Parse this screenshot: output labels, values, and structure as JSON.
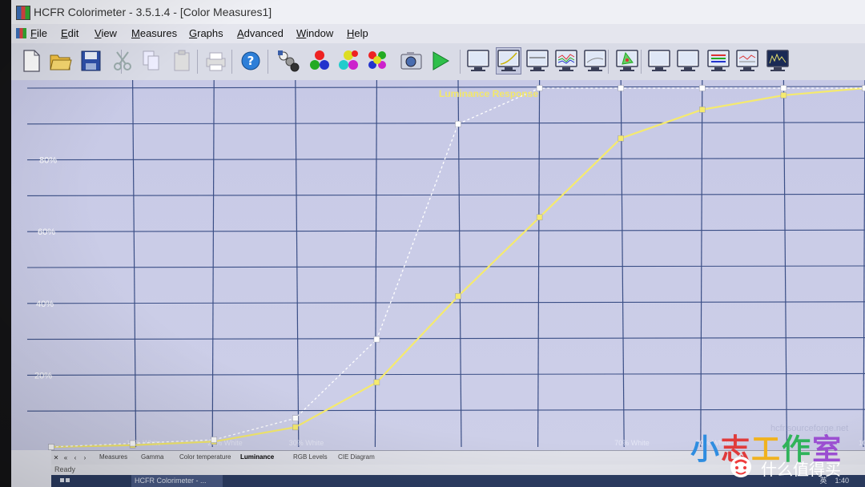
{
  "window": {
    "title": "HCFR Colorimeter - 3.5.1.4 - [Color Measures1]"
  },
  "menu": [
    {
      "label": "File",
      "key": "F"
    },
    {
      "label": "Edit",
      "key": "E"
    },
    {
      "label": "View",
      "key": "V"
    },
    {
      "label": "Measures",
      "key": "M"
    },
    {
      "label": "Graphs",
      "key": "G"
    },
    {
      "label": "Advanced",
      "key": "A"
    },
    {
      "label": "Window",
      "key": "W"
    },
    {
      "label": "Help",
      "key": "H"
    }
  ],
  "toolbar": {
    "icons": [
      "new-document-icon",
      "open-folder-icon",
      "save-disk-icon",
      "cut-icon",
      "copy-icon",
      "paste-icon",
      "print-icon",
      "help-icon",
      "measure-grayscale-icon",
      "measure-primaries-icon",
      "measure-secondaries-icon",
      "measure-all-colors-icon",
      "camera-icon",
      "play-icon",
      "graph-monitor-icon",
      "luminance-graph-icon",
      "gamma-graph-icon",
      "rgb-levels-graph-icon",
      "color-temperature-graph-icon",
      "cie-diagram-icon",
      "graph-monitor-icon",
      "graph-monitor-icon",
      "rgb-histogram-icon",
      "saturation-graph-icon",
      "spectrum-monitor-icon"
    ]
  },
  "chart_data": {
    "type": "line",
    "title": "Luminance Response",
    "x": [
      0,
      10,
      20,
      30,
      40,
      50,
      60,
      70,
      80,
      90,
      100
    ],
    "x_tick_labels": [
      "",
      "10% White",
      "20% White",
      "30% White",
      "",
      "",
      "",
      "70% White",
      "80% White",
      "",
      "100% White"
    ],
    "y_tick_labels": [
      "20%",
      "40%",
      "60%",
      "80%"
    ],
    "ylim": [
      0,
      100
    ],
    "grid": true,
    "series": [
      {
        "color": "#f5ea6e",
        "style": "solid",
        "values": [
          0,
          0.5,
          1.5,
          5.5,
          18,
          42,
          64,
          86,
          94,
          98,
          100
        ]
      },
      {
        "color": "#ffffff",
        "style": "dashed",
        "values": [
          0,
          1,
          2,
          8,
          30,
          90,
          100,
          100,
          100,
          100,
          100
        ]
      }
    ],
    "footer_text": "hcfr.sourceforge.net"
  },
  "tabs": [
    "Measures",
    "Gamma",
    "Color temperature",
    "Luminance",
    "RGB Levels",
    "CIE Diagram"
  ],
  "active_tab": "Luminance",
  "tab_nav": [
    "✕",
    "«",
    "‹",
    "›"
  ],
  "status": {
    "text": "Ready"
  },
  "taskbar": {
    "app": "HCFR Colorimeter - ...",
    "tray_ime": "英",
    "tray_time": "1:40"
  },
  "watermark": {
    "chars": [
      "小",
      "志",
      "工",
      "作",
      "室"
    ],
    "colors": [
      "#2f8de0",
      "#e03b3b",
      "#f0b21e",
      "#2fb35a",
      "#9b4fd1"
    ],
    "tagline": "什么值得买"
  }
}
